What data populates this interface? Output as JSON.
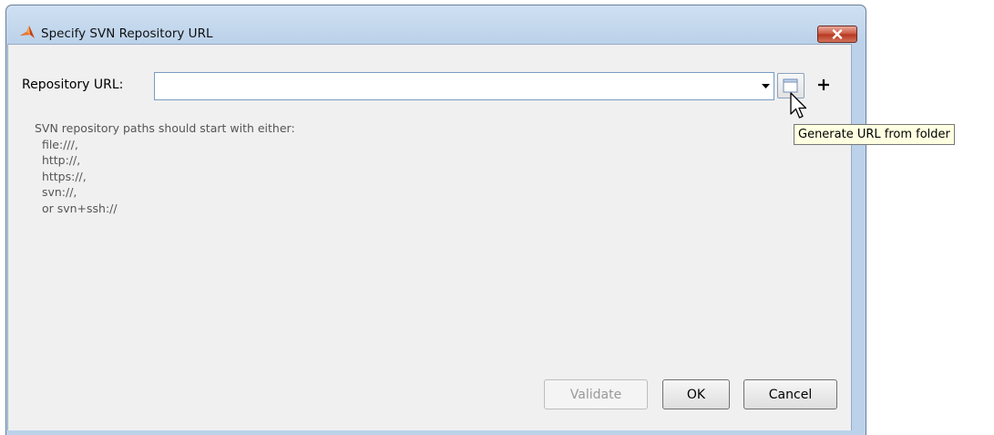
{
  "window": {
    "title": "Specify SVN Repository URL"
  },
  "form": {
    "url_label": "Repository URL:",
    "url_value": ""
  },
  "tooltip": {
    "text": "Generate URL from folder"
  },
  "help": {
    "lines": [
      "SVN repository paths should start with either:",
      "  file:///,",
      "  http://,",
      "  https://,",
      "  svn://,",
      "  or svn+ssh://"
    ]
  },
  "buttons": {
    "validate": "Validate",
    "ok": "OK",
    "cancel": "Cancel",
    "add": "+"
  },
  "icons": {
    "app": "matlab-logo-icon",
    "close": "close-icon",
    "dropdown": "chevron-down-icon",
    "browse": "folder-icon",
    "cursor": "mouse-pointer-icon"
  }
}
